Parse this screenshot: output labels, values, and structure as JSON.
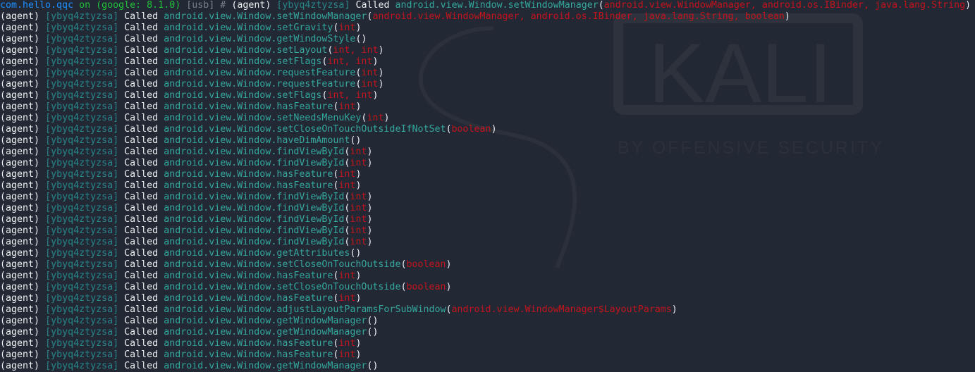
{
  "colors": {
    "background": "#222834",
    "text": "#eef0f2",
    "session": "#27878a",
    "method": "#35a79d",
    "args": "#c4141c",
    "prompt_app": "#1e90ff",
    "prompt_device": "#22c13c"
  },
  "logo": {
    "name": "kali-logo-watermark",
    "title": "KALI",
    "subtitle": "BY OFFENSIVE SECURITY"
  },
  "prompt": {
    "app": "com.hello.qqc",
    "on": "on",
    "device": "(google: 8.1.0)",
    "transport": "[usb]",
    "hash": "#"
  },
  "source": "(agent)",
  "session": "[ybyq4ztyzsa]",
  "verb": "Called",
  "class": "android.view.Window.",
  "lines": [
    {
      "m": "setWindowManager",
      "a": "android.view.WindowManager, android.os.IBinder, java.lang.String"
    },
    {
      "m": "setWindowManager",
      "a": "android.view.WindowManager, android.os.IBinder, java.lang.String, boolean"
    },
    {
      "m": "setGravity",
      "a": "int"
    },
    {
      "m": "getWindowStyle",
      "a": ""
    },
    {
      "m": "setLayout",
      "a": "int, int"
    },
    {
      "m": "setFlags",
      "a": "int, int"
    },
    {
      "m": "requestFeature",
      "a": "int"
    },
    {
      "m": "requestFeature",
      "a": "int"
    },
    {
      "m": "setFlags",
      "a": "int, int"
    },
    {
      "m": "hasFeature",
      "a": "int"
    },
    {
      "m": "setNeedsMenuKey",
      "a": "int"
    },
    {
      "m": "setCloseOnTouchOutsideIfNotSet",
      "a": "boolean"
    },
    {
      "m": "haveDimAmount",
      "a": ""
    },
    {
      "m": "findViewById",
      "a": "int"
    },
    {
      "m": "findViewById",
      "a": "int"
    },
    {
      "m": "hasFeature",
      "a": "int"
    },
    {
      "m": "hasFeature",
      "a": "int"
    },
    {
      "m": "findViewById",
      "a": "int"
    },
    {
      "m": "findViewById",
      "a": "int"
    },
    {
      "m": "findViewById",
      "a": "int"
    },
    {
      "m": "findViewById",
      "a": "int"
    },
    {
      "m": "findViewById",
      "a": "int"
    },
    {
      "m": "getAttributes",
      "a": ""
    },
    {
      "m": "setCloseOnTouchOutside",
      "a": "boolean"
    },
    {
      "m": "hasFeature",
      "a": "int"
    },
    {
      "m": "setCloseOnTouchOutside",
      "a": "boolean"
    },
    {
      "m": "hasFeature",
      "a": "int"
    },
    {
      "m": "adjustLayoutParamsForSubWindow",
      "a": "android.view.WindowManager$LayoutParams"
    },
    {
      "m": "getWindowManager",
      "a": ""
    },
    {
      "m": "getWindowManager",
      "a": ""
    },
    {
      "m": "hasFeature",
      "a": "int"
    },
    {
      "m": "hasFeature",
      "a": "int"
    },
    {
      "m": "getWindowManager",
      "a": ""
    }
  ]
}
